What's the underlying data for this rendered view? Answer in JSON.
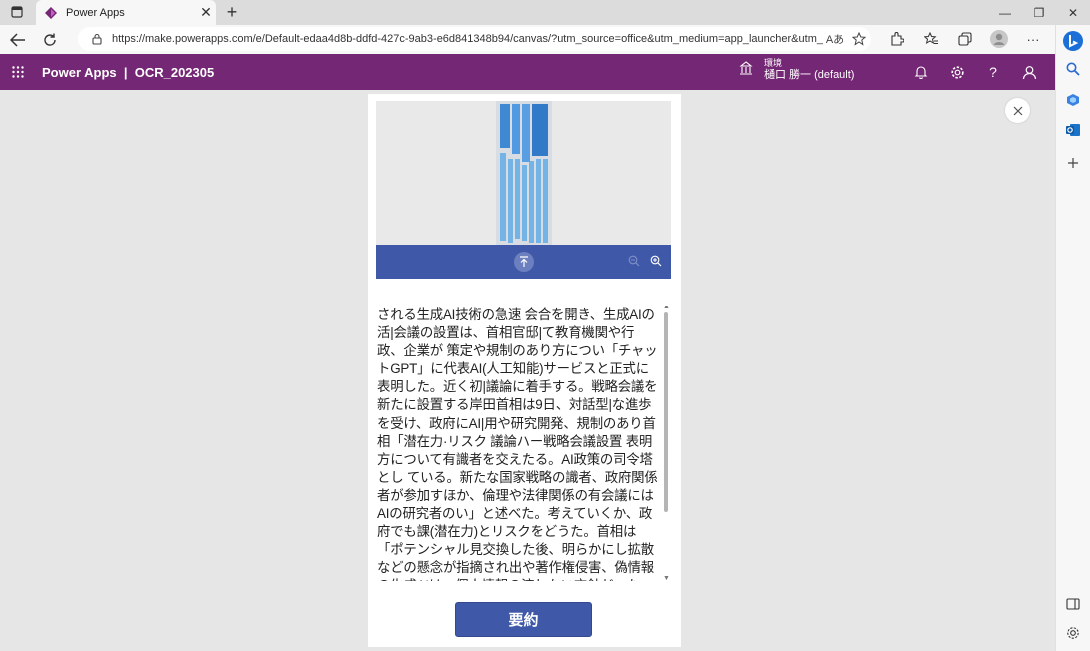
{
  "browser": {
    "tab": {
      "title": "Power Apps",
      "close_glyph": "✕"
    },
    "newtab_glyph": "+",
    "window_controls": [
      "—",
      "❐",
      "✕"
    ],
    "url": "https://make.powerapps.com/e/Default-edaa4d8b-ddfd-427c-9ab3-e6d841348b94/canvas/?utm_source=office&utm_medium=app_launcher&utm_…",
    "read_aloud_glyph": "Aあ",
    "more_glyph": "···"
  },
  "header": {
    "title": "Power Apps  |  OCR_202305",
    "env_label": "環境",
    "env_name": "樋口 勝一 (default)",
    "help_glyph": "?"
  },
  "app": {
    "ocr_text": "される生成AI技術の急速 会合を開き、生成AIの活|会議の設置は、首相官邸|て教育機関や行政、企業が 策定や規制のあり方につい「チャットGPT」に代表AI(人工知能)サービスと正式に表明した。近く初|議論に着手する。戦略会議を新たに設置する岸田首相は9日、対話型|な進歩を受け、政府にAI|用や研究開発、規制のあり首相「潜在力·リスク 議論ハー戦略会議設置 表明方について有識者を交えたる。AI政策の司令塔とし ている。新たな国家戦略の識者、政府関係者が参加すほか、倫理や法律関係の有会議にはAIの研究者のい」と述べた。考えていくか、政府でも課(潜在力)とリスクをどうた。首相は「ポテンシャル見交換した後、明らかにし拡散などの懸念が指摘され出や著作権侵害、偽情報の生成AIは、個人情報の流しない方針だった。ただ、題に対応し",
    "summarize_label": "要約"
  },
  "colors": {
    "header_bg": "#742774",
    "button_bg": "#3f58a8"
  }
}
